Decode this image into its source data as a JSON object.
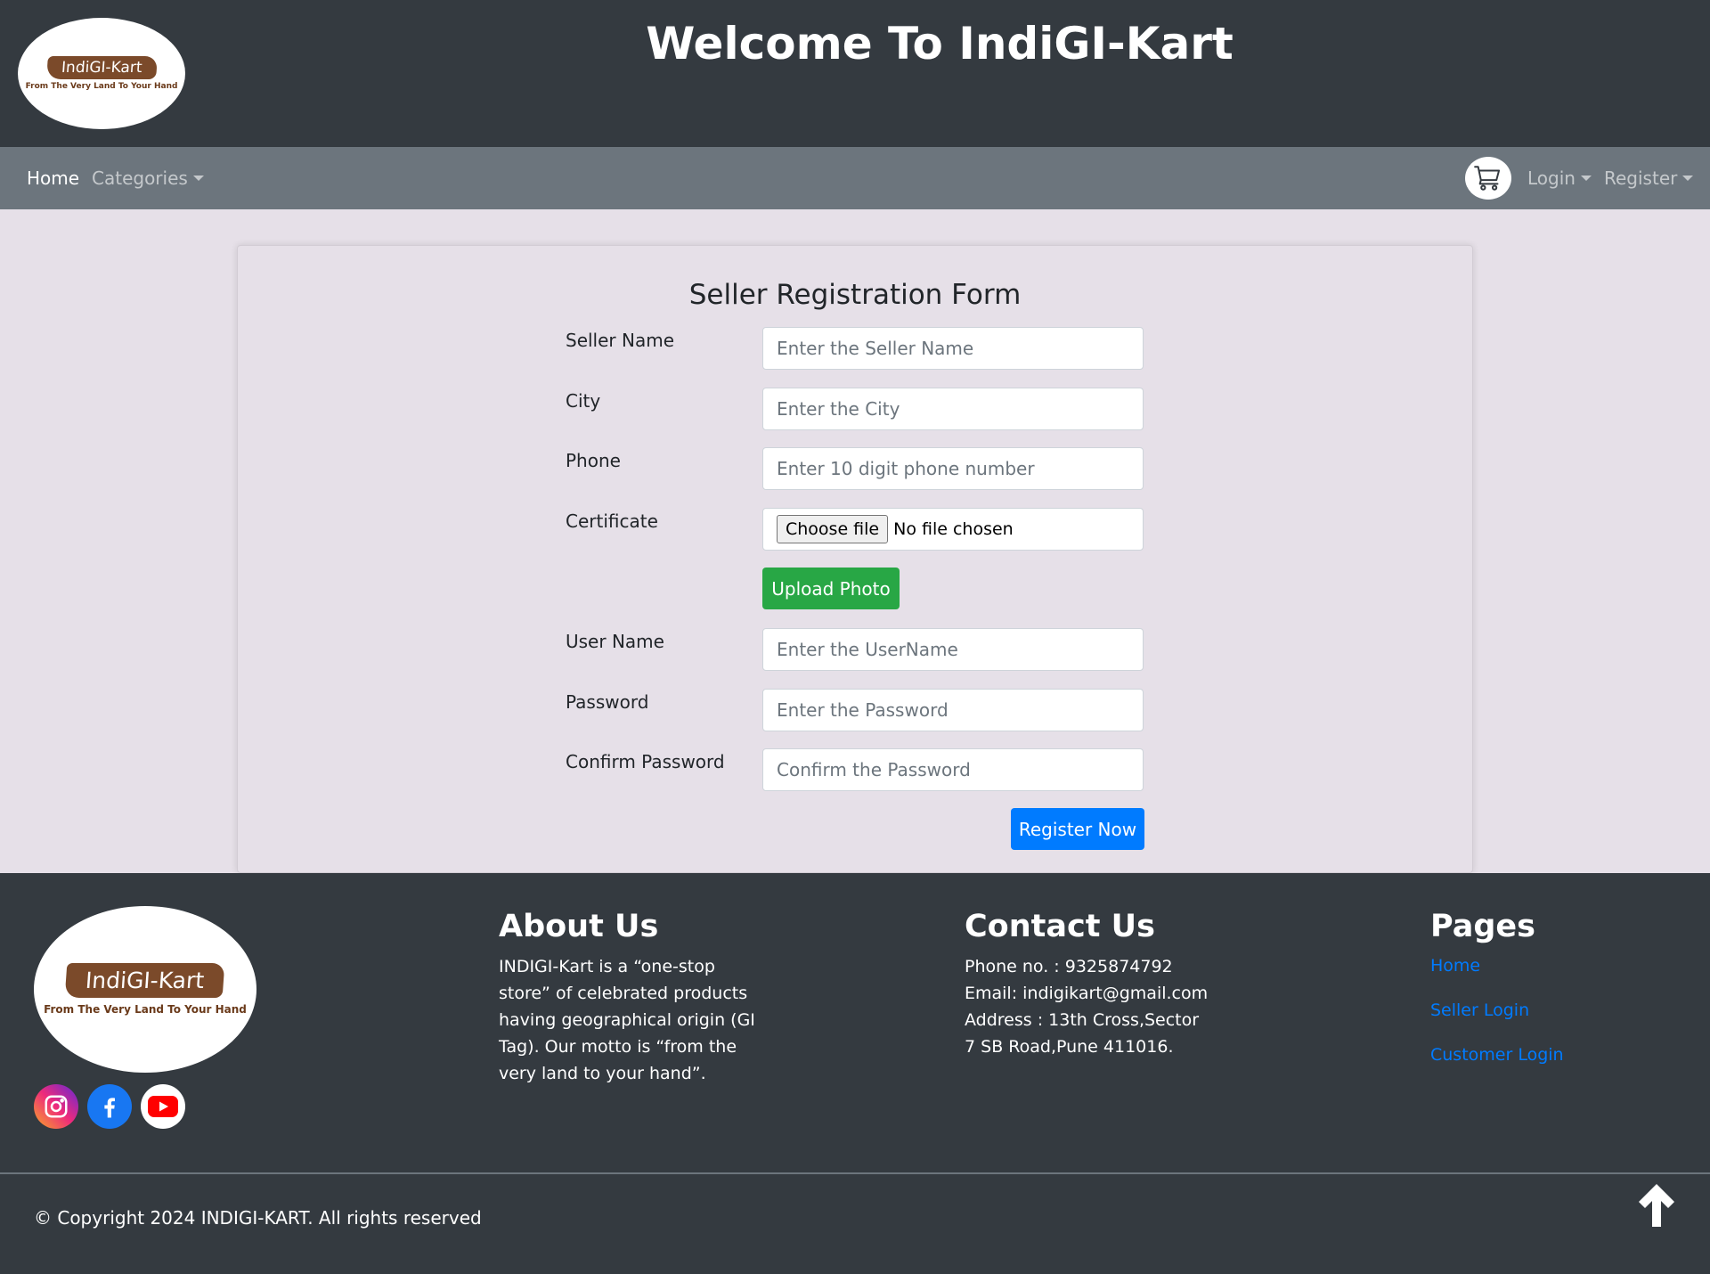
{
  "header": {
    "title": "Welcome To IndiGI-Kart",
    "logo_text": "IndiGI-Kart",
    "logo_tagline": "From The Very Land To Your Hand"
  },
  "navbar": {
    "home": "Home",
    "categories": "Categories",
    "login": "Login",
    "register": "Register",
    "cart_icon": "cart-icon"
  },
  "form": {
    "title": "Seller Registration Form",
    "fields": [
      {
        "label": "Seller Name",
        "placeholder": "Enter the Seller Name"
      },
      {
        "label": "City",
        "placeholder": "Enter the City"
      },
      {
        "label": "Phone",
        "placeholder": "Enter 10 digit phone number"
      },
      {
        "label": "Certificate"
      },
      {
        "label": "User Name",
        "placeholder": "Enter the UserName"
      },
      {
        "label": "Password",
        "placeholder": "Enter the Password"
      },
      {
        "label": "Confirm Password",
        "placeholder": "Confirm the Password"
      }
    ],
    "file_button": "Choose file",
    "file_status": "No file chosen",
    "upload_button": "Upload Photo",
    "submit_button": "Register Now"
  },
  "footer": {
    "logo_text": "IndiGI-Kart",
    "logo_tagline": "From The Very Land To Your Hand",
    "social_icons": [
      "instagram-icon",
      "facebook-icon",
      "youtube-icon"
    ],
    "about": {
      "heading": "About Us",
      "lines": [
        "INDIGI-Kart is a “one-stop",
        "store” of celebrated products",
        "having geographical origin (GI",
        "Tag). Our motto is “from the",
        "very land to your hand”."
      ]
    },
    "contact": {
      "heading": "Contact Us",
      "lines": [
        "Phone no. : 9325874792",
        "Email: indigikart@gmail.com",
        "Address : 13th Cross,Sector",
        "7 SB Road,Pune 411016."
      ]
    },
    "pages": {
      "heading": "Pages",
      "links": [
        "Home",
        "Seller Login",
        "Customer Login"
      ]
    },
    "copyright": "© Copyright 2024 INDIGI-KART. All rights reserved"
  },
  "colors": {
    "header_bg": "#343a40",
    "navbar_bg": "#6c757d",
    "page_bg": "#e6e0e8",
    "success": "#28a745",
    "primary": "#007bff",
    "logo_brown": "#7b4a2a"
  }
}
